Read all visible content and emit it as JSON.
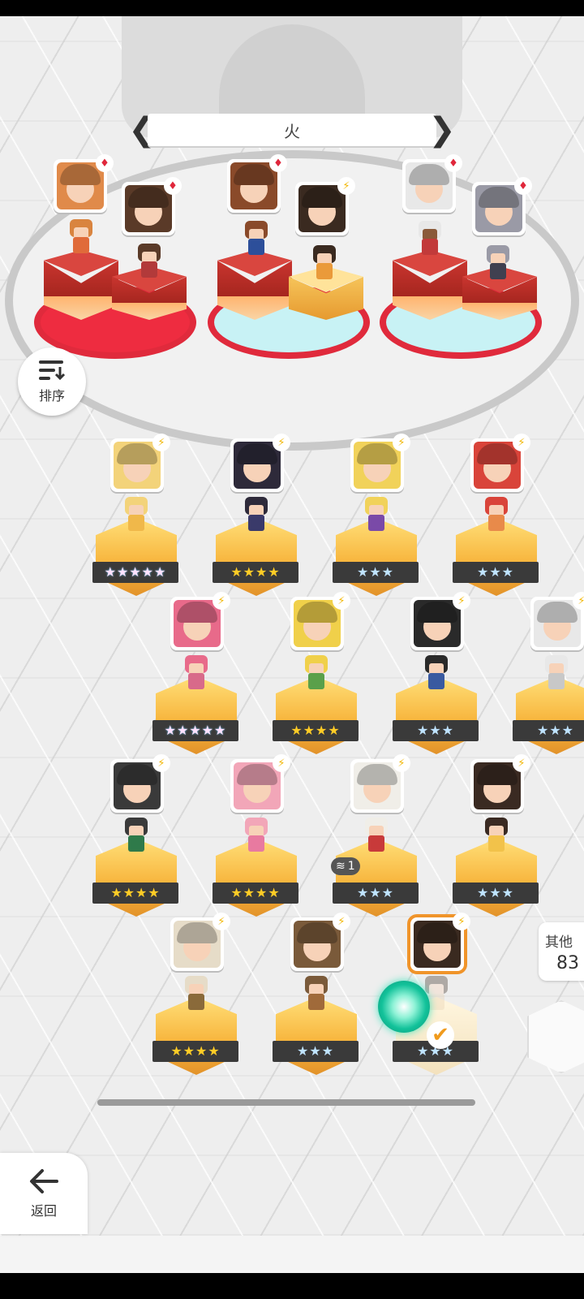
{
  "header": {
    "element_title": "火"
  },
  "buttons": {
    "sort_label": "排序",
    "back_label": "返回"
  },
  "others": {
    "label": "其他",
    "count": "83"
  },
  "badge": {
    "count": "1"
  },
  "colors": {
    "accent": "#f0942a",
    "pad_red": "#ee2c40",
    "pad_cyan": "#c8f2f5",
    "star_gold": "#ffcc26",
    "star_silver": "#bfe3ff"
  },
  "team": [
    {
      "tag": "suit"
    },
    {
      "tag": "suit"
    },
    {
      "tag": "suit"
    },
    {
      "tag": "bolt"
    },
    {
      "tag": "suit"
    },
    {
      "tag": "suit"
    }
  ],
  "roster": [
    {
      "stars": "★★★★★",
      "tier": "rainbow",
      "tag": "bolt"
    },
    {
      "stars": "★★★★",
      "tier": "gold",
      "tag": "bolt"
    },
    {
      "stars": "★★★",
      "tier": "silver",
      "tag": "bolt"
    },
    {
      "stars": "★★★",
      "tier": "silver",
      "tag": "bolt"
    },
    {
      "stars": "★★★★★",
      "tier": "rainbow",
      "tag": "bolt"
    },
    {
      "stars": "★★★★",
      "tier": "gold",
      "tag": "bolt"
    },
    {
      "stars": "★★★",
      "tier": "silver",
      "tag": "bolt"
    },
    {
      "stars": "★★★",
      "tier": "silver",
      "tag": "bolt"
    },
    {
      "stars": "★★★★",
      "tier": "gold",
      "tag": "bolt"
    },
    {
      "stars": "★★★★",
      "tier": "gold",
      "tag": "bolt"
    },
    {
      "stars": "★★★",
      "tier": "silver",
      "tag": "bolt"
    },
    {
      "stars": "★★★",
      "tier": "silver",
      "tag": "bolt"
    },
    {
      "stars": "★★★★",
      "tier": "gold",
      "tag": "bolt"
    },
    {
      "stars": "★★★",
      "tier": "silver",
      "tag": "bolt"
    },
    {
      "stars": "★★★",
      "tier": "silver",
      "tag": "bolt",
      "selected": true
    }
  ]
}
